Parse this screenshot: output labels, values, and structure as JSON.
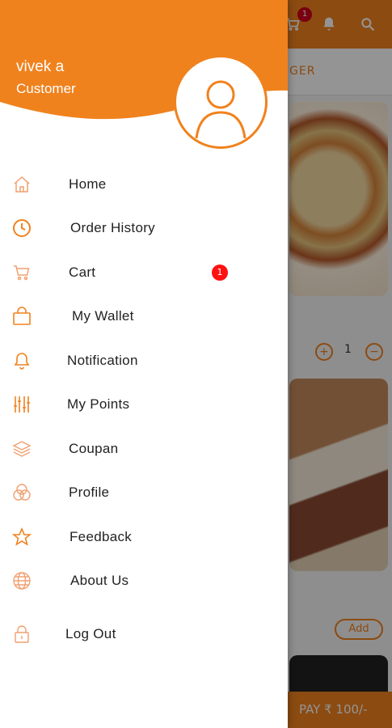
{
  "background": {
    "cart_badge": "1",
    "tab_partial": "GER",
    "qty_minus": "−",
    "qty_plus": "+",
    "qty_value": "1",
    "add_label": "Add",
    "pay_label": "PAY ₹ 100/-"
  },
  "drawer": {
    "user_name": "vivek a",
    "user_role": "Customer",
    "menu": [
      {
        "label": "Home",
        "icon": "home-icon"
      },
      {
        "label": "Order History",
        "icon": "clock-icon"
      },
      {
        "label": "Cart",
        "icon": "cart-icon",
        "badge": "1"
      },
      {
        "label": "My Wallet",
        "icon": "wallet-bag-icon"
      },
      {
        "label": "Notification",
        "icon": "bell-icon"
      },
      {
        "label": "My Points",
        "icon": "sliders-icon"
      },
      {
        "label": "Coupan",
        "icon": "layers-icon"
      },
      {
        "label": "Profile",
        "icon": "circles-icon"
      },
      {
        "label": "Feedback",
        "icon": "star-icon"
      },
      {
        "label": "About Us",
        "icon": "globe-icon"
      },
      {
        "label": "Log Out",
        "icon": "lock-icon"
      }
    ]
  },
  "colors": {
    "accent": "#f0821e",
    "badge": "#ff1111"
  }
}
